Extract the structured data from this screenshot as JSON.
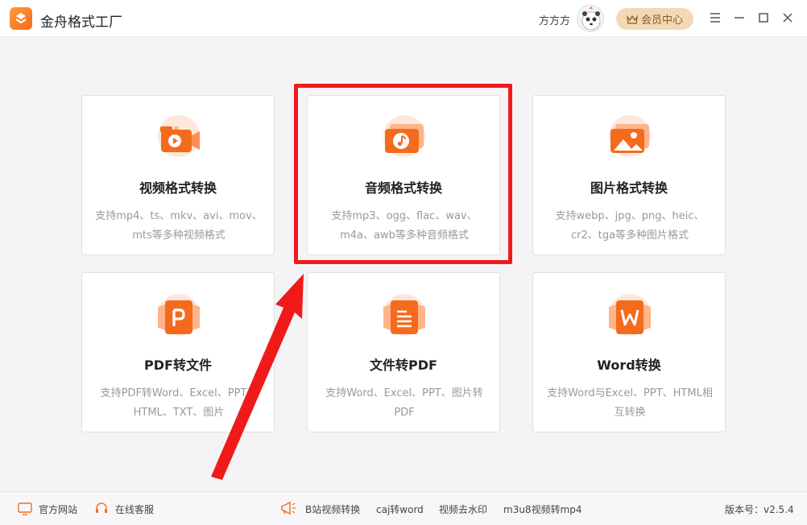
{
  "app": {
    "title": "金舟格式工厂",
    "username": "方方方",
    "vip_label": "会员中心"
  },
  "cards": [
    {
      "title": "视频格式转换",
      "desc": "支持mp4、ts、mkv、avi、mov、mts等多种视频格式",
      "icon": "video-icon"
    },
    {
      "title": "音频格式转换",
      "desc": "支持mp3、ogg、flac、wav、m4a、awb等多种音频格式",
      "icon": "audio-icon"
    },
    {
      "title": "图片格式转换",
      "desc": "支持webp、jpg、png、heic、cr2、tga等多种图片格式",
      "icon": "image-icon"
    },
    {
      "title": "PDF转文件",
      "desc": "支持PDF转Word、Excel、PPT、HTML、TXT、图片",
      "icon": "pdf-icon"
    },
    {
      "title": "文件转PDF",
      "desc": "支持Word、Excel、PPT、图片转PDF",
      "icon": "document-icon"
    },
    {
      "title": "Word转换",
      "desc": "支持Word与Excel、PPT、HTML相互转换",
      "icon": "word-icon"
    }
  ],
  "footer": {
    "official_site": "官方网站",
    "online_service": "在线客服",
    "links": [
      "B站视频转换",
      "caj转word",
      "视频去水印",
      "m3u8视频转mp4"
    ],
    "version_label": "版本号：v2.5.4"
  },
  "colors": {
    "accent": "#f46b1e",
    "highlight": "#f01a1a",
    "vip_bg": "#f2d9b6"
  }
}
